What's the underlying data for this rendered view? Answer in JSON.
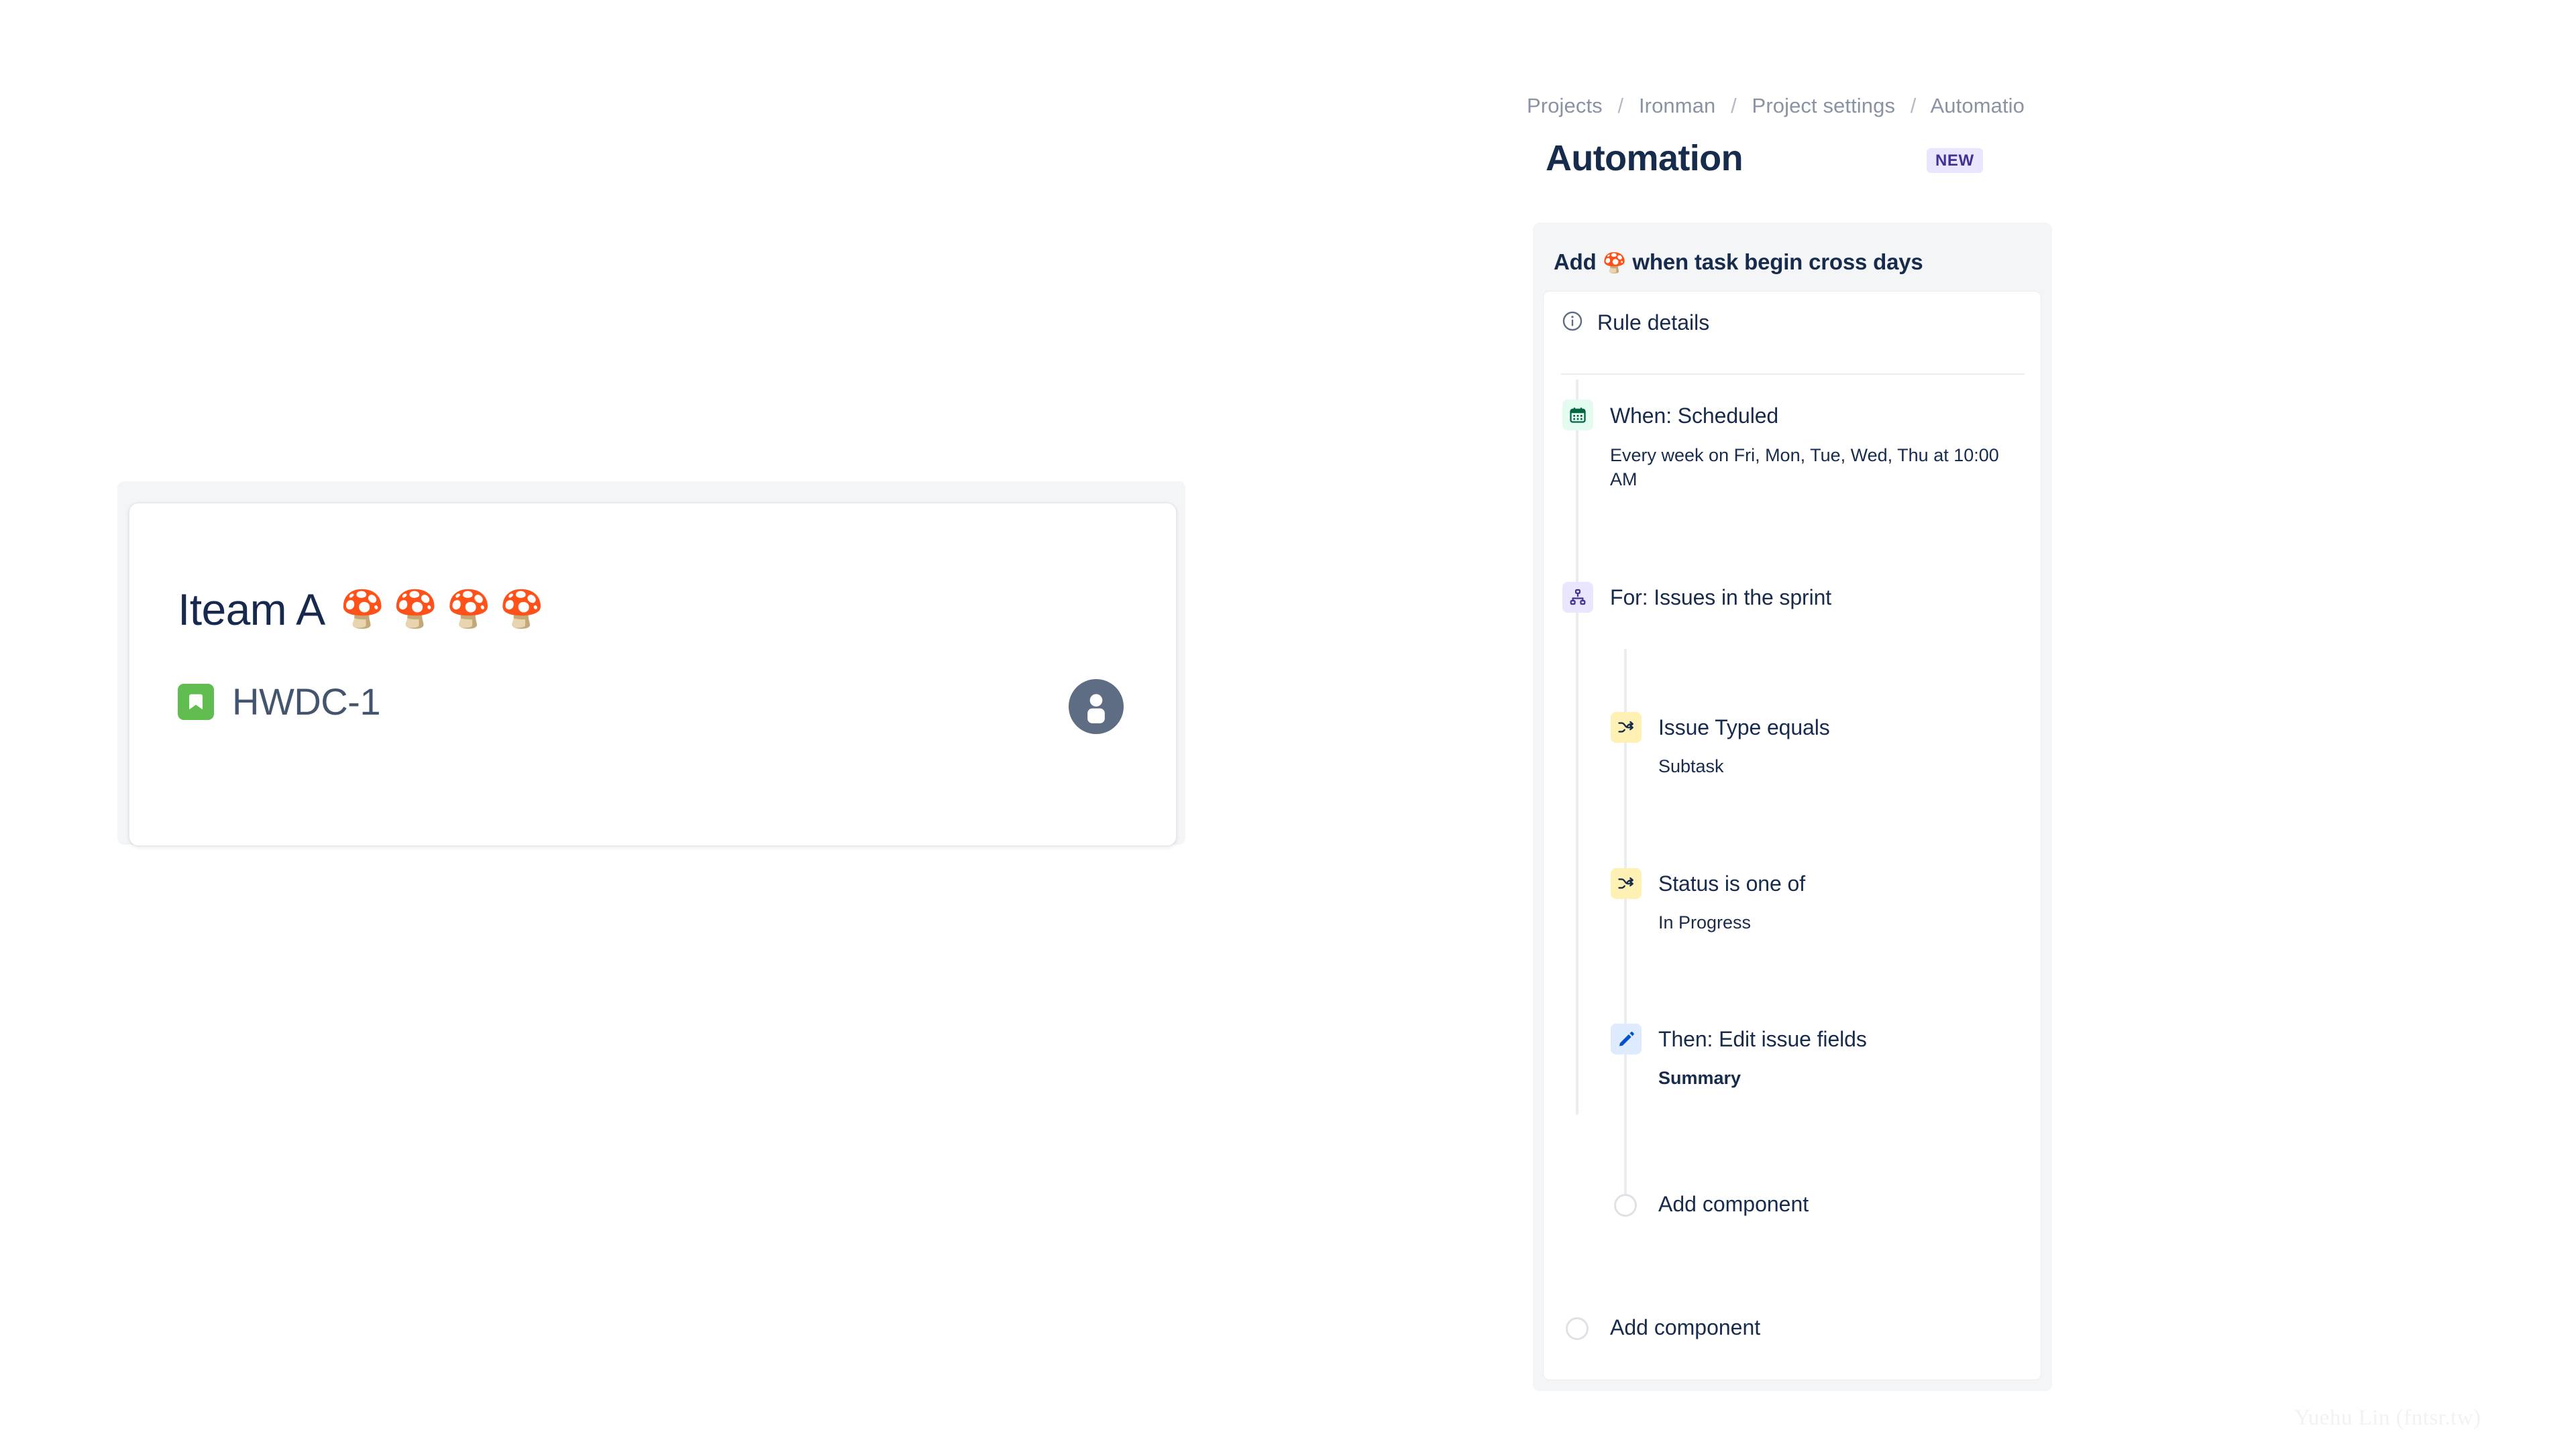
{
  "issue_card": {
    "title_text": "Iteam A",
    "title_emoji": "🍄🍄🍄🍄",
    "issue_key": "HWDC-1",
    "issue_type_icon": "story-bookmark-icon",
    "assignee_avatar": "default-user-avatar",
    "accent_green": "#61bd4f",
    "avatar_color": "#5e6c84"
  },
  "breadcrumb": {
    "items": [
      "Projects",
      "Ironman",
      "Project settings",
      "Automatio"
    ],
    "separator": "/"
  },
  "header": {
    "title": "Automation",
    "badge": "NEW",
    "badge_bg": "#eae6ff",
    "badge_fg": "#403294"
  },
  "rule": {
    "heading_prefix": "Add ",
    "heading_emoji": "🍄",
    "heading_suffix": " when task begin cross days",
    "details_label": "Rule details",
    "details_icon": "info-icon",
    "trigger": {
      "icon": "calendar-icon",
      "icon_bg": "#e3fcef",
      "title": "When: Scheduled",
      "subtitle": "Every week on Fri, Mon, Tue, Wed, Thu at 10:00 AM"
    },
    "scope": {
      "icon": "branch-icon",
      "icon_bg": "#eae6ff",
      "title": "For: Issues in the sprint"
    },
    "components": [
      {
        "icon": "shuffle-icon",
        "icon_bg": "#fff0b3",
        "title": "Issue Type equals",
        "subtitle": "Subtask",
        "bold_subtitle": false
      },
      {
        "icon": "shuffle-icon",
        "icon_bg": "#fff0b3",
        "title": "Status is one of",
        "subtitle": "In Progress",
        "bold_subtitle": false
      },
      {
        "icon": "pencil-icon",
        "icon_bg": "#deebff",
        "title": "Then: Edit issue fields",
        "subtitle": "Summary",
        "bold_subtitle": true
      }
    ],
    "add_component_nested": "Add component",
    "add_component_root": "Add component"
  },
  "watermark": "Yuehu Lin (fntsr.tw)"
}
